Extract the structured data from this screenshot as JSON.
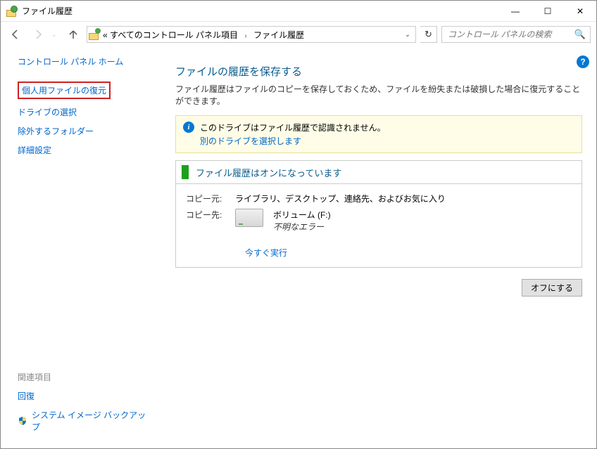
{
  "window": {
    "title": "ファイル履歴"
  },
  "nav": {
    "breadcrumb_prefix": "«",
    "breadcrumb_part1": "すべてのコントロール パネル項目",
    "breadcrumb_part2": "ファイル履歴",
    "search_placeholder": "コントロール パネルの検索"
  },
  "sidebar": {
    "home": "コントロール パネル ホーム",
    "restore": "個人用ファイルの復元",
    "select_drive": "ドライブの選択",
    "exclude": "除外するフォルダー",
    "advanced": "詳細設定",
    "related_heading": "関連項目",
    "recovery": "回復",
    "system_image": "システム イメージ バックアップ"
  },
  "main": {
    "heading": "ファイルの履歴を保存する",
    "description": "ファイル履歴はファイルのコピーを保存しておくため、ファイルを紛失または破損した場合に復元することができます。",
    "warning": {
      "text": "このドライブはファイル履歴で認識されません。",
      "link": "別のドライブを選択します"
    },
    "status": {
      "title": "ファイル履歴はオンになっています",
      "source_label": "コピー元:",
      "source_value": "ライブラリ、デスクトップ、連絡先、およびお気に入り",
      "dest_label": "コピー先:",
      "dest_name": "ボリューム (F:)",
      "dest_error": "不明なエラー",
      "run_now": "今すぐ実行"
    },
    "button_off": "オフにする"
  }
}
